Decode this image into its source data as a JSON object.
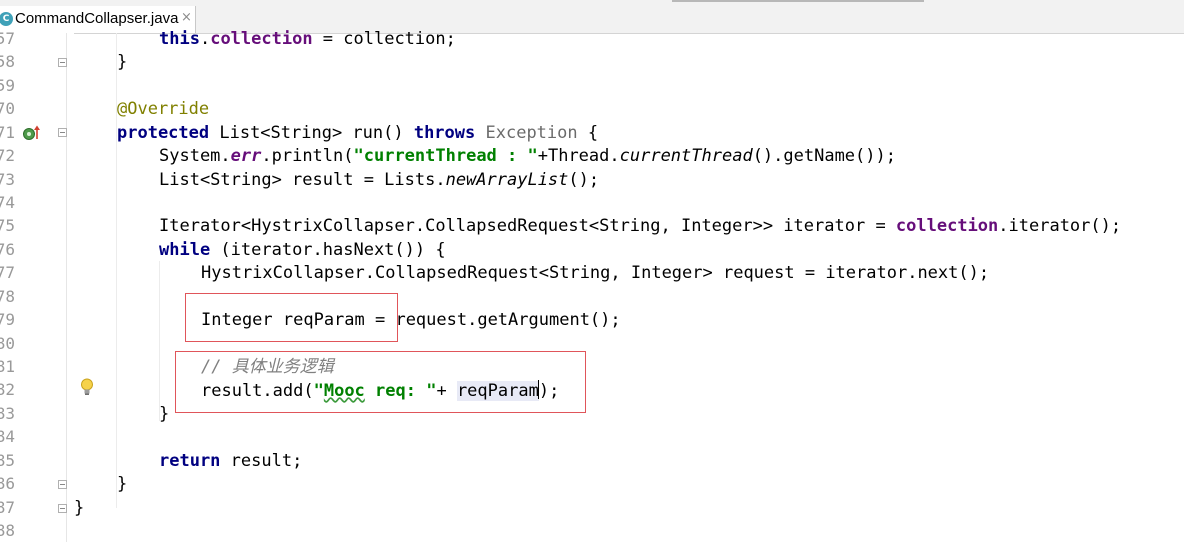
{
  "tab": {
    "icon": "java-class-icon",
    "icon_glyph": "C",
    "label": "CommandCollapser.java",
    "close_glyph": "×"
  },
  "gutter": {
    "line_numbers": [
      "57",
      "58",
      "59",
      "70",
      "71",
      "72",
      "73",
      "74",
      "75",
      "76",
      "77",
      "78",
      "79",
      "80",
      "81",
      "82",
      "83",
      "84",
      "85",
      "86",
      "87",
      "88"
    ],
    "icons": [
      "override-marker-icon",
      "lightbulb-icon"
    ]
  },
  "code": {
    "l57a": "this",
    "l57b": ".",
    "l57c": "collection",
    "l57d": " = collection;",
    "l58": "}",
    "l70": "@Override",
    "l71a": "protected",
    "l71b": " List<String> run() ",
    "l71c": "throws",
    "l71d": " ",
    "l71e": "Exception",
    "l71f": " {",
    "l72a": "System.",
    "l72b": "err",
    "l72c": ".println(",
    "l72d": "\"currentThread : \"",
    "l72e": "+Thread.",
    "l72f": "currentThread",
    "l72g": "().getName());",
    "l73a": "List<String> result = Lists.",
    "l73b": "newArrayList",
    "l73c": "();",
    "l75a": "Iterator<HystrixCollapser.CollapsedRequest<String, Integer>> iterator = ",
    "l75b": "collection",
    "l75c": ".iterator();",
    "l76a": "while",
    "l76b": " (iterator.hasNext()) {",
    "l77": "HystrixCollapser.CollapsedRequest<String, Integer> request = iterator.next();",
    "l79": "Integer reqParam = request.getArgument();",
    "l81": "// 具体业务逻辑",
    "l82a": "result.add(",
    "l82b": "\"",
    "l82c": "Mooc",
    "l82d": " req: \"",
    "l82e": "+ ",
    "l82f": "reqParam",
    "l82g": ");",
    "l83": "}",
    "l85a": "return",
    "l85b": " result;",
    "l86": "}",
    "l87": "}"
  },
  "colors": {
    "keyword": "#000080",
    "field": "#660e7a",
    "annotation": "#808000",
    "string": "#008000",
    "comment": "#808080",
    "highlight_box": "#e0555a"
  }
}
